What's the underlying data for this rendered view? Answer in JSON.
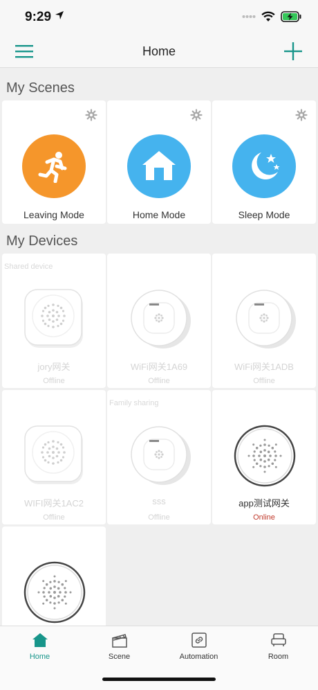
{
  "status_bar": {
    "time": "9:29"
  },
  "nav": {
    "title": "Home"
  },
  "sections": {
    "scenes_title": "My Scenes",
    "devices_title": "My Devices"
  },
  "scenes": [
    {
      "label": "Leaving Mode",
      "color": "#f5962b",
      "icon": "running-person-icon"
    },
    {
      "label": "Home Mode",
      "color": "#45b3ee",
      "icon": "house-icon"
    },
    {
      "label": "Sleep Mode",
      "color": "#45b3ee",
      "icon": "moon-stars-icon"
    }
  ],
  "devices": [
    {
      "tag": "Shared device",
      "name": "jory网关",
      "status": "Offline",
      "image": "square-gateway-icon"
    },
    {
      "tag": "",
      "name": "WiFi网关1A69",
      "status": "Offline",
      "image": "round-smoke-detector-icon"
    },
    {
      "tag": "",
      "name": "WiFi网关1ADB",
      "status": "Offline",
      "image": "round-smoke-detector-icon"
    },
    {
      "tag": "",
      "name": "WIFI网关1AC2",
      "status": "Offline",
      "image": "square-gateway-icon"
    },
    {
      "tag": "Family sharing",
      "name": "sss",
      "status": "Offline",
      "image": "round-smoke-detector-icon"
    },
    {
      "tag": "",
      "name": "app测试网关",
      "status": "Online",
      "image": "circular-speaker-icon"
    },
    {
      "tag": "",
      "name": "",
      "status": "",
      "image": "circular-speaker-icon"
    }
  ],
  "tabs": [
    {
      "label": "Home",
      "icon": "home-icon",
      "active": true
    },
    {
      "label": "Scene",
      "icon": "clapperboard-icon",
      "active": false
    },
    {
      "label": "Automation",
      "icon": "link-icon",
      "active": false
    },
    {
      "label": "Room",
      "icon": "armchair-icon",
      "active": false
    }
  ],
  "colors": {
    "accent": "#17958a",
    "online": "#c0392b"
  }
}
